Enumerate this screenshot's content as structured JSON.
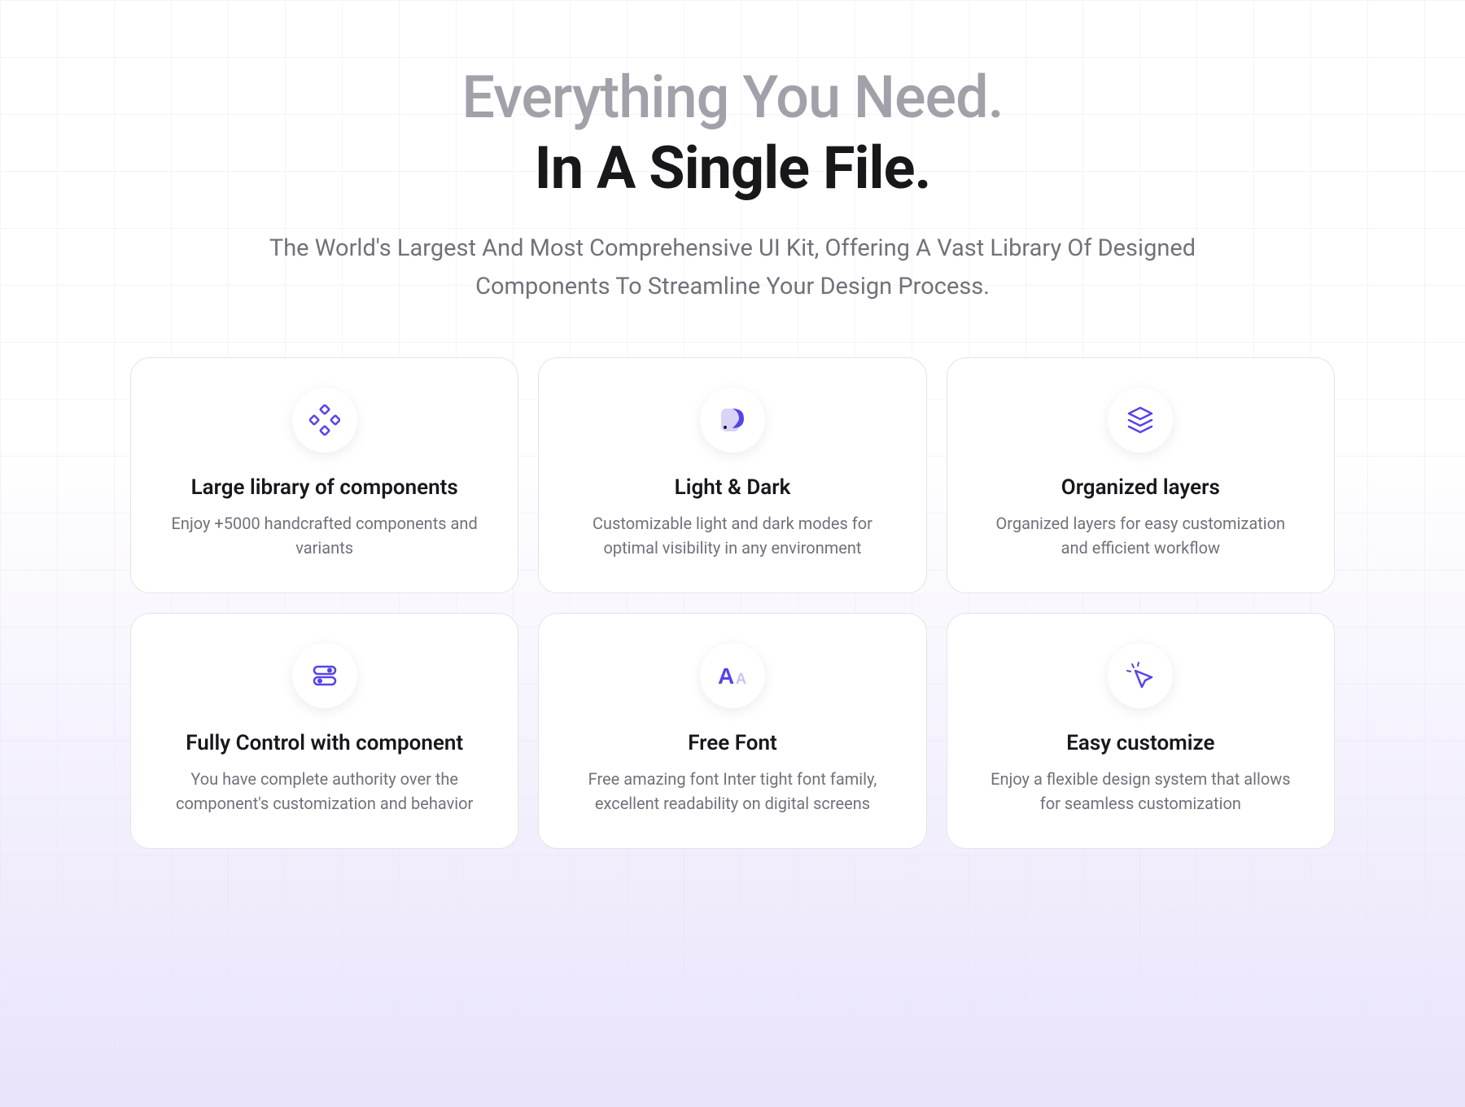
{
  "header": {
    "line1": "Everything You Need.",
    "line2": "In A Single File.",
    "subheading": "The World's Largest And Most Comprehensive UI Kit, Offering A Vast Library Of Designed Components To Streamline Your Design Process."
  },
  "cards": [
    {
      "title": "Large library of components",
      "description": "Enjoy +5000 handcrafted components and variants",
      "icon": "components-icon"
    },
    {
      "title": "Light & Dark",
      "description": "Customizable light and dark modes for optimal visibility in any environment",
      "icon": "light-dark-icon"
    },
    {
      "title": "Organized layers",
      "description": "Organized layers for easy customization and efficient workflow",
      "icon": "layers-icon"
    },
    {
      "title": "Fully Control with component",
      "description": "You have complete authority over the component's customization and behavior",
      "icon": "sliders-icon"
    },
    {
      "title": "Free Font",
      "description": "Free amazing font Inter tight font family, excellent readability on digital screens",
      "icon": "font-icon"
    },
    {
      "title": "Easy customize",
      "description": "Enjoy a flexible design system that allows for seamless customization",
      "icon": "cursor-icon"
    }
  ],
  "colors": {
    "accent": "#5544E8",
    "accentLight": "#c7c0f5"
  }
}
